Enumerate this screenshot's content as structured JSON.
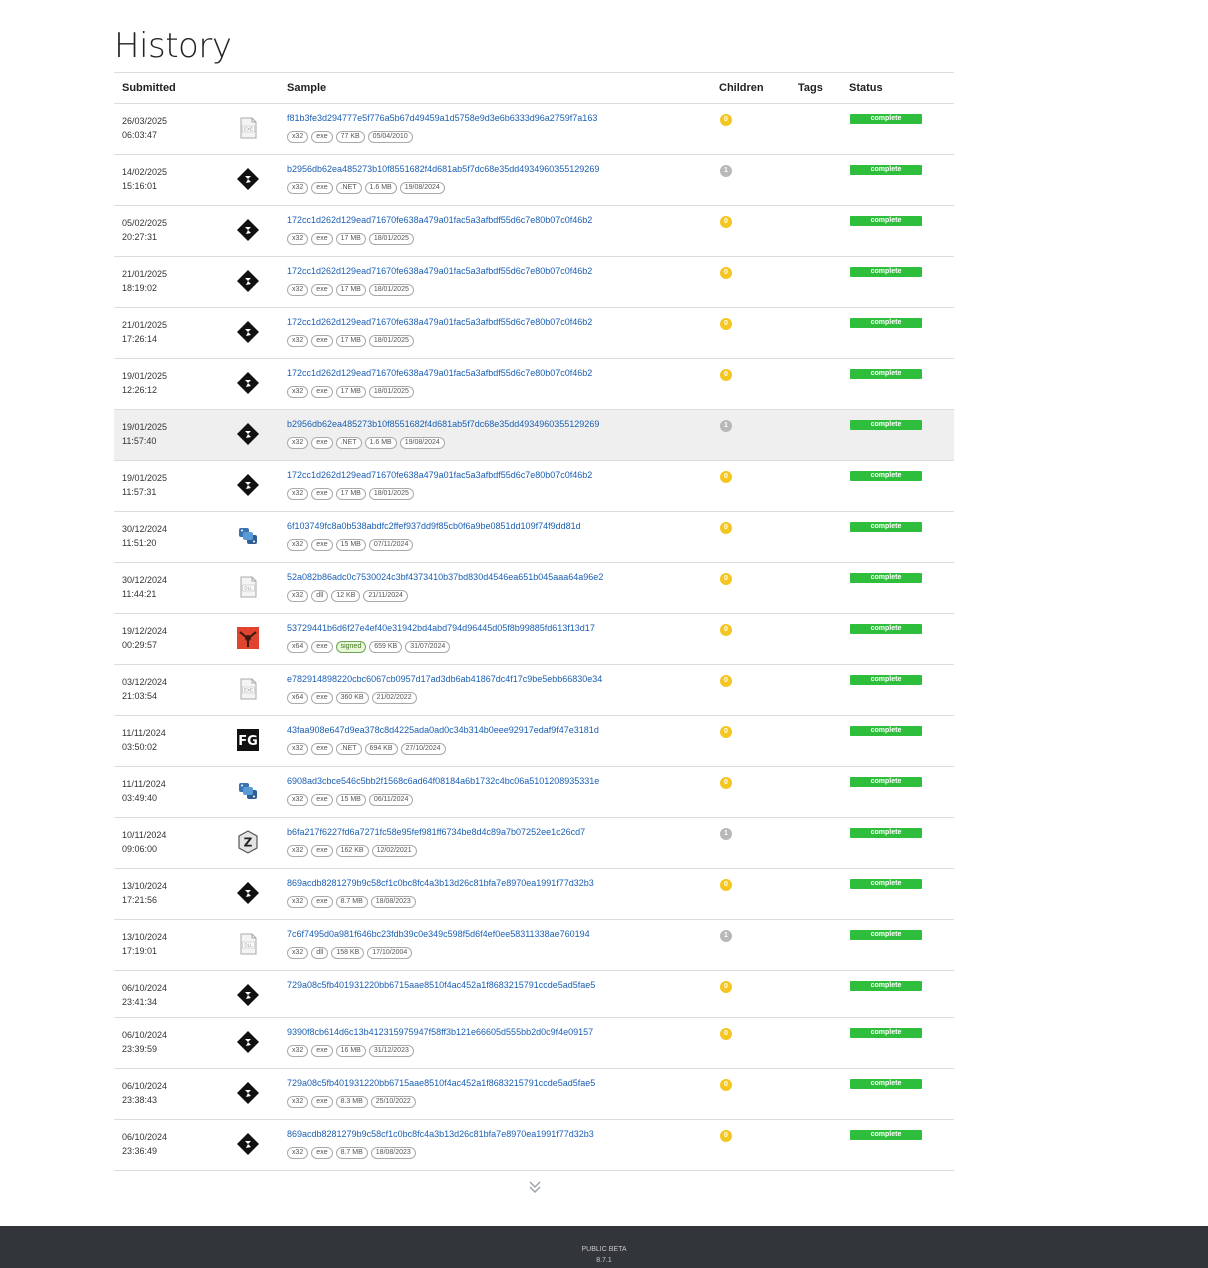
{
  "page": {
    "title": "History"
  },
  "table": {
    "headers": {
      "submitted": "Submitted",
      "sample": "Sample",
      "children": "Children",
      "tags": "Tags",
      "status": "Status"
    },
    "rows": [
      {
        "date": "26/03/2025",
        "time": "06:03:47",
        "icon": "exe-file-icon",
        "hash": "f81b3fe3d294777e5f776a5b67d49459a1d5758e9d3e6b6333d96a2759f7a163",
        "tags": [
          "x32",
          "exe",
          "77 KB",
          "05/04/2010"
        ],
        "children": "0",
        "children_color": "yellow",
        "status": "complete",
        "highlighted": false
      },
      {
        "date": "14/02/2025",
        "time": "15:16:01",
        "icon": "diamond-logo-icon",
        "hash": "b2956db62ea485273b10f8551682f4d681ab5f7dc68e35dd4934960355129269",
        "tags": [
          "x32",
          "exe",
          ".NET",
          "1.6 MB",
          "19/08/2024"
        ],
        "children": "1",
        "children_color": "gray",
        "status": "complete",
        "highlighted": false
      },
      {
        "date": "05/02/2025",
        "time": "20:27:31",
        "icon": "diamond-logo-icon",
        "hash": "172cc1d262d129ead71670fe638a479a01fac5a3afbdf55d6c7e80b07c0f46b2",
        "tags": [
          "x32",
          "exe",
          "17 MB",
          "18/01/2025"
        ],
        "children": "0",
        "children_color": "yellow",
        "status": "complete",
        "highlighted": false
      },
      {
        "date": "21/01/2025",
        "time": "18:19:02",
        "icon": "diamond-logo-icon",
        "hash": "172cc1d262d129ead71670fe638a479a01fac5a3afbdf55d6c7e80b07c0f46b2",
        "tags": [
          "x32",
          "exe",
          "17 MB",
          "18/01/2025"
        ],
        "children": "0",
        "children_color": "yellow",
        "status": "complete",
        "highlighted": false
      },
      {
        "date": "21/01/2025",
        "time": "17:26:14",
        "icon": "diamond-logo-icon",
        "hash": "172cc1d262d129ead71670fe638a479a01fac5a3afbdf55d6c7e80b07c0f46b2",
        "tags": [
          "x32",
          "exe",
          "17 MB",
          "18/01/2025"
        ],
        "children": "0",
        "children_color": "yellow",
        "status": "complete",
        "highlighted": false
      },
      {
        "date": "19/01/2025",
        "time": "12:26:12",
        "icon": "diamond-logo-icon",
        "hash": "172cc1d262d129ead71670fe638a479a01fac5a3afbdf55d6c7e80b07c0f46b2",
        "tags": [
          "x32",
          "exe",
          "17 MB",
          "18/01/2025"
        ],
        "children": "0",
        "children_color": "yellow",
        "status": "complete",
        "highlighted": false
      },
      {
        "date": "19/01/2025",
        "time": "11:57:40",
        "icon": "diamond-logo-icon",
        "hash": "b2956db62ea485273b10f8551682f4d681ab5f7dc68e35dd4934960355129269",
        "tags": [
          "x32",
          "exe",
          ".NET",
          "1.6 MB",
          "19/08/2024"
        ],
        "children": "1",
        "children_color": "gray",
        "status": "complete",
        "highlighted": true
      },
      {
        "date": "19/01/2025",
        "time": "11:57:31",
        "icon": "diamond-logo-icon",
        "hash": "172cc1d262d129ead71670fe638a479a01fac5a3afbdf55d6c7e80b07c0f46b2",
        "tags": [
          "x32",
          "exe",
          "17 MB",
          "18/01/2025"
        ],
        "children": "0",
        "children_color": "yellow",
        "status": "complete",
        "highlighted": false
      },
      {
        "date": "30/12/2024",
        "time": "11:51:20",
        "icon": "python-logo-icon",
        "hash": "6f103749fc8a0b538abdfc2ffef937dd9f85cb0f6a9be0851dd109f74f9dd81d",
        "tags": [
          "x32",
          "exe",
          "15 MB",
          "07/11/2024"
        ],
        "children": "0",
        "children_color": "yellow",
        "status": "complete",
        "highlighted": false
      },
      {
        "date": "30/12/2024",
        "time": "11:44:21",
        "icon": "dll-file-icon",
        "hash": "52a082b86adc0c7530024c3bf4373410b37bd830d4546ea651b045aaa64a96e2",
        "tags": [
          "x32",
          "dll",
          "12 KB",
          "21/11/2024"
        ],
        "children": "0",
        "children_color": "yellow",
        "status": "complete",
        "highlighted": false
      },
      {
        "date": "19/12/2024",
        "time": "00:29:57",
        "icon": "red-app-icon",
        "hash": "53729441b6d6f27e4ef40e31942bd4abd794d96445d05f8b99885fd613f13d17",
        "tags": [
          "x64",
          "exe",
          "signed",
          "659 KB",
          "31/07/2024"
        ],
        "children": "0",
        "children_color": "yellow",
        "status": "complete",
        "highlighted": false
      },
      {
        "date": "03/12/2024",
        "time": "21:03:54",
        "icon": "exe-file-icon",
        "hash": "e782914898220cbc6067cb0957d17ad3db6ab41867dc4f17c9be5ebb66830e34",
        "tags": [
          "x64",
          "exe",
          "360 KB",
          "21/02/2022"
        ],
        "children": "0",
        "children_color": "yellow",
        "status": "complete",
        "highlighted": false
      },
      {
        "date": "11/11/2024",
        "time": "03:50:02",
        "icon": "fg-logo-icon",
        "hash": "43faa908e647d9ea378c8d4225ada0ad0c34b314b0eee92917edaf9f47e3181d",
        "tags": [
          "x32",
          "exe",
          ".NET",
          "694 KB",
          "27/10/2024"
        ],
        "children": "0",
        "children_color": "yellow",
        "status": "complete",
        "highlighted": false
      },
      {
        "date": "11/11/2024",
        "time": "03:49:40",
        "icon": "python-logo-icon",
        "hash": "6908ad3cbce546c5bb2f1568c6ad64f08184a6b1732c4bc06a5101208935331e",
        "tags": [
          "x32",
          "exe",
          "15 MB",
          "06/11/2024"
        ],
        "children": "0",
        "children_color": "yellow",
        "status": "complete",
        "highlighted": false
      },
      {
        "date": "10/11/2024",
        "time": "09:06:00",
        "icon": "z-badge-icon",
        "hash": "b6fa217f6227fd6a7271fc58e95fef981ff6734be8d4c89a7b07252ee1c26cd7",
        "tags": [
          "x32",
          "exe",
          "162 KB",
          "12/02/2021"
        ],
        "children": "1",
        "children_color": "gray",
        "status": "complete",
        "highlighted": false
      },
      {
        "date": "13/10/2024",
        "time": "17:21:56",
        "icon": "diamond-logo-icon",
        "hash": "869acdb8281279b9c58cf1c0bc8fc4a3b13d26c81bfa7e8970ea1991f77d32b3",
        "tags": [
          "x32",
          "exe",
          "8.7 MB",
          "18/08/2023"
        ],
        "children": "0",
        "children_color": "yellow",
        "status": "complete",
        "highlighted": false
      },
      {
        "date": "13/10/2024",
        "time": "17:19:01",
        "icon": "dll-file-icon",
        "hash": "7c6f7495d0a981f646bc23fdb39c0e349c598f5d6f4ef0ee58311338ae760194",
        "tags": [
          "x32",
          "dll",
          "158 KB",
          "17/10/2004"
        ],
        "children": "1",
        "children_color": "gray",
        "status": "complete",
        "highlighted": false
      },
      {
        "date": "06/10/2024",
        "time": "23:41:34",
        "icon": "diamond-logo-icon",
        "hash": "729a08c5fb401931220bb6715aae8510f4ac452a1f8683215791ccde5ad5fae5",
        "tags": [],
        "children": "0",
        "children_color": "yellow",
        "status": "complete",
        "highlighted": false
      },
      {
        "date": "06/10/2024",
        "time": "23:39:59",
        "icon": "diamond-logo-icon",
        "hash": "9390f8cb614d6c13b412315975947f58ff3b121e66605d555bb2d0c9f4e09157",
        "tags": [
          "x32",
          "exe",
          "16 MB",
          "31/12/2023"
        ],
        "children": "0",
        "children_color": "yellow",
        "status": "complete",
        "highlighted": false
      },
      {
        "date": "06/10/2024",
        "time": "23:38:43",
        "icon": "diamond-logo-icon",
        "hash": "729a08c5fb401931220bb6715aae8510f4ac452a1f8683215791ccde5ad5fae5",
        "tags": [
          "x32",
          "exe",
          "8.3 MB",
          "25/10/2022"
        ],
        "children": "0",
        "children_color": "yellow",
        "status": "complete",
        "highlighted": false
      },
      {
        "date": "06/10/2024",
        "time": "23:36:49",
        "icon": "diamond-logo-icon",
        "hash": "869acdb8281279b9c58cf1c0bc8fc4a3b13d26c81bfa7e8970ea1991f77d32b3",
        "tags": [
          "x32",
          "exe",
          "8.7 MB",
          "18/08/2023"
        ],
        "children": "0",
        "children_color": "yellow",
        "status": "complete",
        "highlighted": false
      }
    ]
  },
  "load_more": {
    "icon": "double-chevron-down-icon"
  },
  "footer": {
    "label": "PUBLIC BETA",
    "version": "8.7.1"
  },
  "colors": {
    "status_complete": "#2fbe3c",
    "child_yellow": "#f4c622",
    "child_gray": "#b8b8b8",
    "link": "#1a5fb4",
    "footer_bg": "#32363b",
    "highlight_row": "#efefef"
  }
}
